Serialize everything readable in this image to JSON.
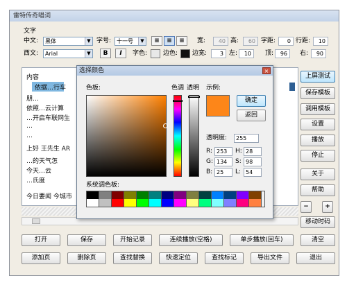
{
  "window": {
    "title": "雷特传奇唱词"
  },
  "font_group": {
    "label": "文字"
  },
  "row1": {
    "chinese_label": "中文:",
    "chinese_font": "黑体",
    "size_label": "字号:",
    "size_value": "十一号",
    "width_label": "宽:",
    "width_value": "40",
    "height_label": "高:",
    "height_value": "60",
    "spacing_label": "字距:",
    "spacing_value": "0",
    "linespacing_label": "行距:",
    "linespacing_value": "10"
  },
  "row2": {
    "western_label": "西文:",
    "western_font": "Arial",
    "bold_label": "B",
    "italic_label": "I",
    "fontcolor_label": "字色:",
    "edgecolor_label": "边色:",
    "edgewidth_label": "边宽:",
    "edgewidth_value": "3",
    "left_label": "左:",
    "left_value": "10",
    "top_label": "顶:",
    "top_value": "96",
    "right_label": "右:",
    "right_value": "90"
  },
  "editor": {
    "lines": [
      "内容",
      "依据…行车",
      "朋…",
      "依照…云计算",
      "…开启车联网生",
      "…",
      "…",
      "上好  王先生  AR",
      "…的天气怎",
      "今天…云",
      "…氏度",
      "今日要闻 今城市"
    ]
  },
  "side_buttons": [
    "上屏测试",
    "保存模板",
    "调用模板",
    "设置",
    "播放",
    "停止",
    "关于",
    "帮助"
  ],
  "minus_label": "−",
  "plus_label": "+",
  "move_label": "移动时码",
  "bottom_row1": [
    "打开",
    "保存",
    "开始记录",
    "连续播放(空格)",
    "单步播放(回车)",
    "清空"
  ],
  "bottom_row2": [
    "添加页",
    "删除页",
    "查找替换",
    "快速定位",
    "查找标记",
    "导出文件",
    "退出"
  ],
  "color_dialog": {
    "title": "选择颜色",
    "palette_label": "色板:",
    "hue_label": "色调",
    "alpha_label": "透明",
    "preview_label": "示例:",
    "ok_label": "确定",
    "back_label": "返回",
    "opacity_label": "透明度:",
    "opacity_value": "255",
    "r_label": "R:",
    "r_value": "253",
    "g_label": "G:",
    "g_value": "134",
    "b_label": "B:",
    "b_value": "25",
    "h_label": "H:",
    "h_value": "28",
    "s_label": "S:",
    "s_value": "98",
    "l_label": "L:",
    "l_value": "54",
    "system_label": "系统调色板:",
    "selected_color": "#fd8619",
    "palette_top": [
      "#000000",
      "#808080",
      "#800000",
      "#808000",
      "#008000",
      "#008080",
      "#000080",
      "#800080",
      "#808040",
      "#004040",
      "#0080ff",
      "#004080",
      "#8000ff",
      "#804000"
    ],
    "palette_bottom": [
      "#ffffff",
      "#c0c0c0",
      "#ff0000",
      "#ffff00",
      "#00ff00",
      "#00ffff",
      "#0000ff",
      "#ff00ff",
      "#ffff80",
      "#00ff80",
      "#80ffff",
      "#8080ff",
      "#ff0080",
      "#ff8040"
    ]
  }
}
